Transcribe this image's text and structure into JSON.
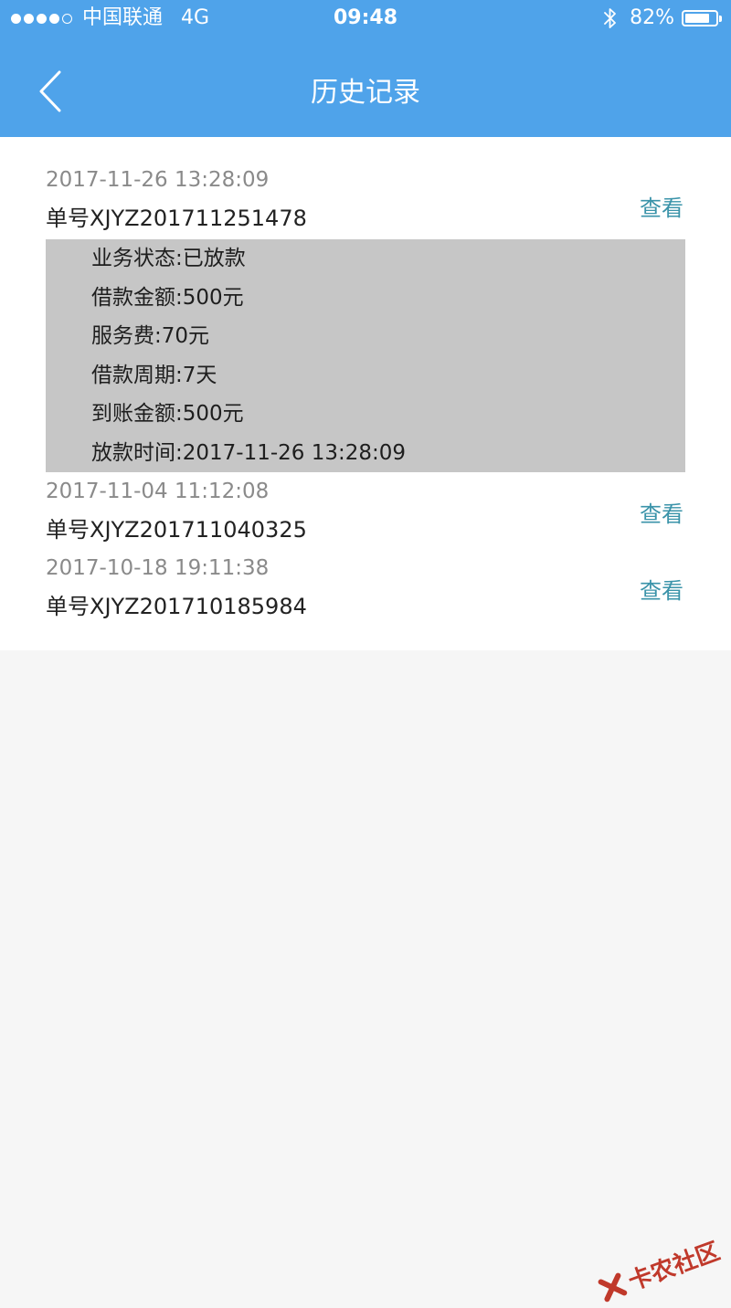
{
  "status_bar": {
    "carrier": "中国联通",
    "network": "4G",
    "time": "09:48",
    "battery": "82%",
    "battery_level": 0.82
  },
  "header": {
    "title": "历史记录",
    "back_icon": "chevron-left-icon"
  },
  "records": [
    {
      "time": "2017-11-26 13:28:09",
      "order_no": "单号XJYZ201711251478",
      "view_label": "查看",
      "expanded": true,
      "details": [
        "业务状态:已放款",
        "借款金额:500元",
        "服务费:70元",
        "借款周期:7天",
        "到账金额:500元",
        "放款时间:2017-11-26 13:28:09"
      ]
    },
    {
      "time": "2017-11-04 11:12:08",
      "order_no": "单号XJYZ201711040325",
      "view_label": "查看",
      "expanded": false
    },
    {
      "time": "2017-10-18 19:11:38",
      "order_no": "单号XJYZ201710185984",
      "view_label": "查看",
      "expanded": false
    }
  ],
  "watermark": {
    "text": "卡农社区"
  },
  "colors": {
    "header": "#4fa3ea",
    "link": "#3a93a9",
    "detail_bg": "#c6c6c6",
    "page_bg": "#f6f6f6"
  }
}
